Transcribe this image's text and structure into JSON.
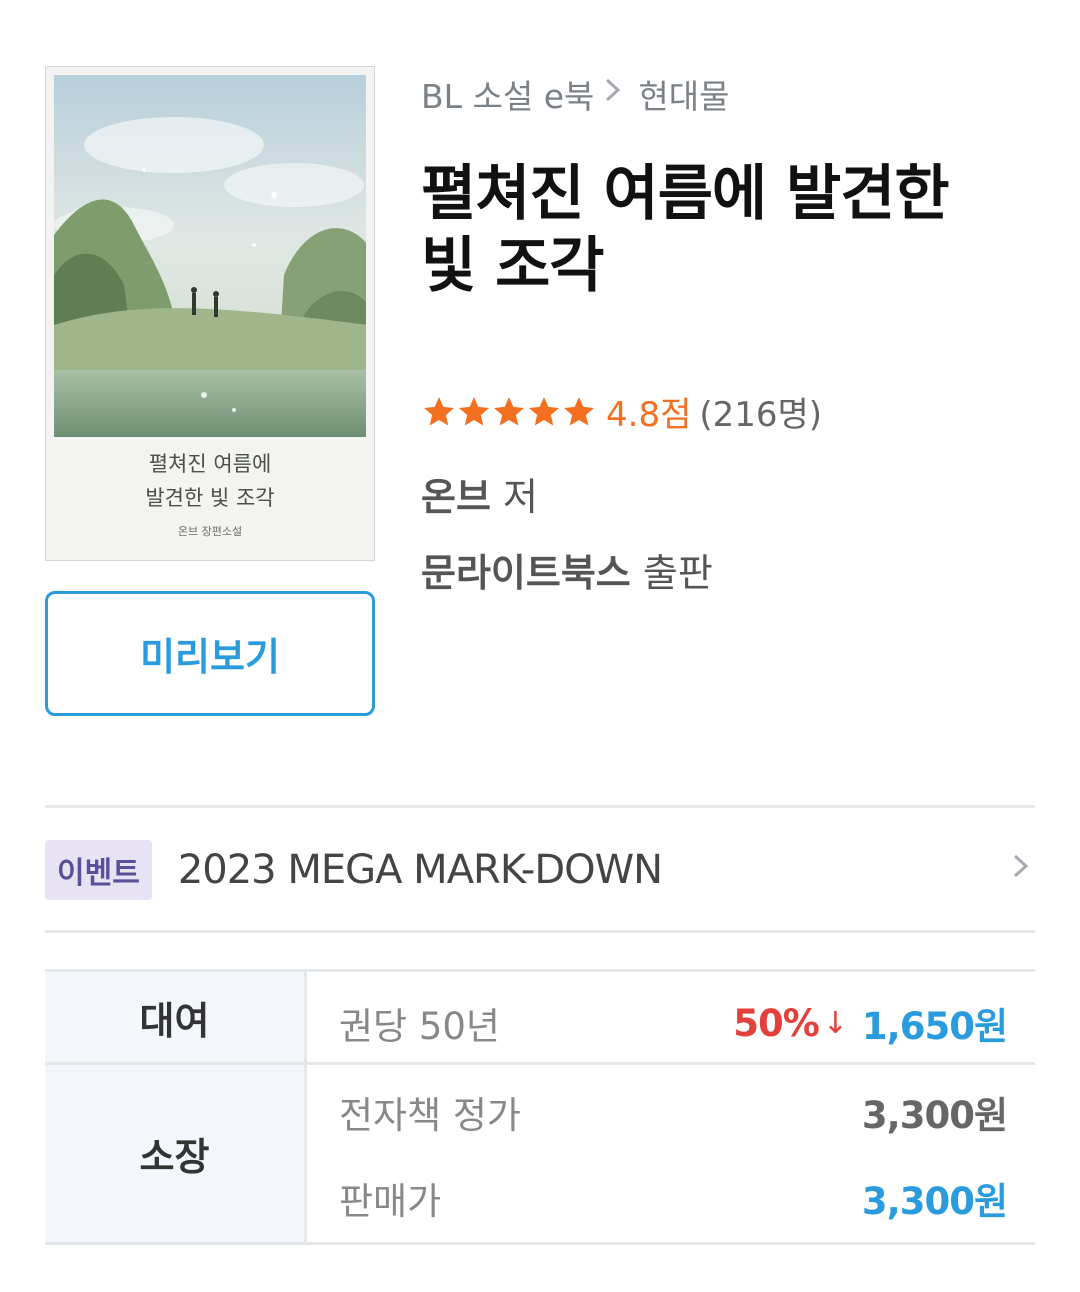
{
  "book": {
    "cover": {
      "title_line1": "펼쳐진 여름에",
      "title_line2": "발견한 빛 조각",
      "author_line": "온브 장편소설"
    },
    "preview_label": "미리보기",
    "breadcrumb": [
      "BL 소설 e북",
      "현대물"
    ],
    "title": "펼쳐진 여름에 발견한 빛 조각",
    "rating": {
      "stars": 5,
      "score": "4.8점",
      "count": "(216명)"
    },
    "author": {
      "name": "온브",
      "role": "저"
    },
    "publisher": {
      "name": "문라이트북스",
      "role": "출판"
    }
  },
  "event": {
    "badge": "이벤트",
    "text": "2023 MEGA MARK-DOWN",
    "chevron": "›"
  },
  "pricing": {
    "rent": {
      "label": "대여",
      "term": "권당 50년",
      "discount": "50%",
      "discount_icon": "↓",
      "price": "1,650원"
    },
    "own": {
      "label": "소장",
      "list_label": "전자책 정가",
      "list_price": "3,300원",
      "sale_label": "판매가",
      "sale_price": "3,300원"
    }
  },
  "colors": {
    "accent": "#2a9bdc",
    "star": "#f37021",
    "discount": "#e2413b"
  }
}
